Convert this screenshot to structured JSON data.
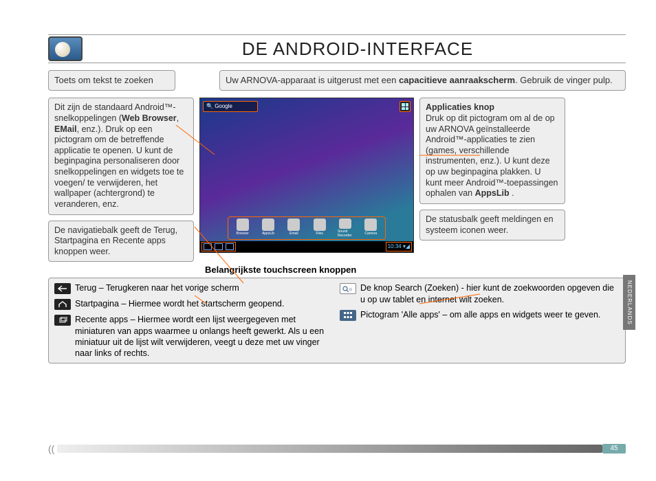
{
  "title": "DE ANDROID-INTERFACE",
  "callouts": {
    "search": "Toets om tekst te zoeken",
    "top": {
      "pre": "Uw ARNOVA-apparaat is uitgerust met een ",
      "bold": "capacitieve aanraakscherm",
      "post": ". Gebruik de vinger pulp."
    },
    "left1": {
      "pre": "Dit zijn de standaard Android™-snelkoppelingen (",
      "b1": "Web Browser",
      "mid1": ", ",
      "b2": "EMail",
      "post": ", enz.). Druk op een pictogram om de betreffende applicatie te openen. U kunt de beginpagina personaliseren door snelkoppelingen en widgets toe te voegen/ te verwijderen, het wallpaper (achtergrond) te veranderen, enz."
    },
    "left2": "De navigatiebalk geeft de Terug, Startpagina en Recente apps knoppen weer.",
    "right1": {
      "title": "Applicaties knop",
      "pre": "Druk op dit pictogram om al de op uw ARNOVA geïnstalleerde Android™-applicaties te zien (games, verschillende instrumenten, enz.). U kunt deze op uw beginpagina plakken. U kunt meer Android™-toepassingen ophalen van ",
      "bold": "AppsLib",
      "post": " ."
    },
    "right2": "De statusbalk geeft meldingen en systeem iconen weer."
  },
  "screenshot": {
    "search_label": "Google",
    "clock": "10:34",
    "dock": [
      "Browser",
      "AppsLib",
      "Email",
      "Files",
      "Sound Recorder",
      "Camera"
    ]
  },
  "subhead": "Belangrijkste touchscreen knoppen",
  "buttons": {
    "back": "Terug – Terugkeren naar het vorige scherm",
    "home": "Startpagina – Hiermee wordt het startscherm geopend.",
    "recent": "Recente apps – Hiermee wordt een lijst weergegeven met miniaturen van apps waarmee u onlangs heeft gewerkt. Als u een miniatuur uit de lijst wilt verwijderen, veegt u deze met uw vinger naar links of rechts.",
    "search": "De knop Search (Zoeken) - hier kunt de zoekwoorden opgeven die u op uw tablet en internet wilt zoeken.",
    "allapps": "Pictogram 'Alle apps' – om alle apps en widgets weer te geven."
  },
  "page_number": "45",
  "side_tab": "NEDERLANDS"
}
